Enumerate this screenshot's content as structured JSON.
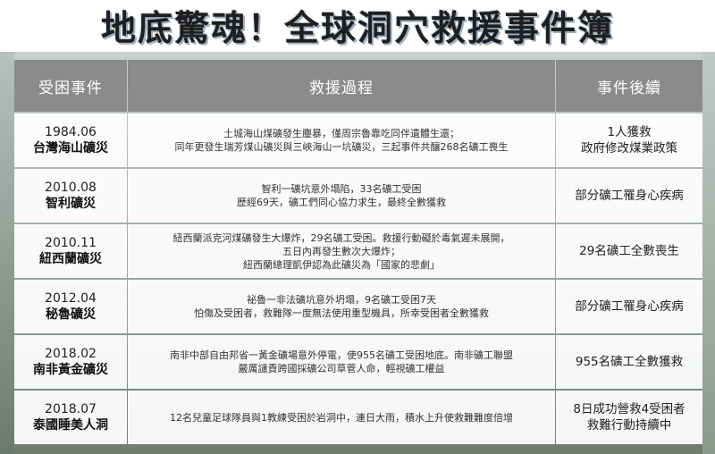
{
  "title": "地底驚魂！全球洞穴救援事件簿",
  "headers": {
    "event": "受困事件",
    "process": "救援過程",
    "outcome": "事件後續"
  },
  "rows": [
    {
      "date": "1984.06",
      "name": "台灣海山礦災",
      "process": [
        "土城海山煤礦發生塵暴，僅周宗魯靠吃同伴遺體生還；",
        "同年更發生瑞芳煤山礦災與三峽海山一坑礦災，三起事件共釀268名礦工喪生"
      ],
      "outcome": [
        "1人獲救",
        "政府修改煤業政策"
      ]
    },
    {
      "date": "2010.08",
      "name": "智利礦災",
      "process": [
        "智利一礦坑意外塌陷，33名礦工受困",
        "歷經69天，礦工們同心協力求生，最終全數獲救"
      ],
      "outcome": [
        "部分礦工罹身心疾病"
      ]
    },
    {
      "date": "2010.11",
      "name": "紐西蘭礦災",
      "process": [
        "紐西蘭派克河煤礦發生大爆炸，29名礦工受困。救援行動礙於毒氣遲未展開，",
        "五日內再發生數次大爆炸；",
        "紐西蘭總理凱伊認為此礦災為「國家的悲劇」"
      ],
      "outcome": [
        "29名礦工全數喪生"
      ]
    },
    {
      "date": "2012.04",
      "name": "秘魯礦災",
      "process": [
        "祕魯一非法礦坑意外坍塌，9名礦工受困7天",
        "怕傷及受困者，救難隊一度無法使用重型機具，所幸受困者全數獲救"
      ],
      "outcome": [
        "部分礦工罹身心疾病"
      ]
    },
    {
      "date": "2018.02",
      "name": "南非黃金礦災",
      "process": [
        "南非中部自由邦省一黃金礦場意外停電，使955名礦工受困地底。南非礦工聯盟",
        "嚴厲譴責跨國採礦公司草菅人命，輕視礦工權益"
      ],
      "outcome": [
        "955名礦工全數獲救"
      ]
    },
    {
      "date": "2018.07",
      "name": "泰國睡美人洞",
      "process": [
        "12名兒童足球隊員與1教練受困於岩洞中，連日大雨，積水上升使救難難度倍增"
      ],
      "outcome": [
        "8日成功營救4受困者",
        "救難行動持續中"
      ]
    }
  ]
}
